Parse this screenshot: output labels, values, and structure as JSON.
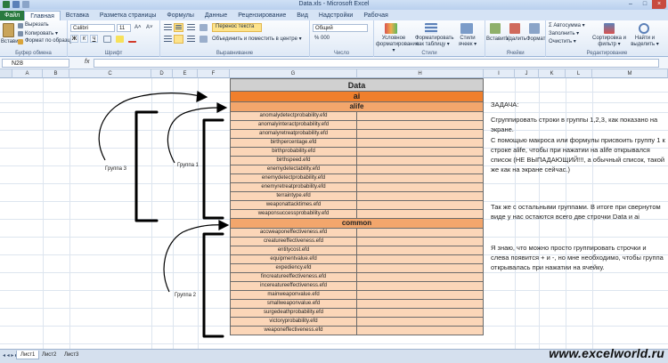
{
  "window": {
    "title": "Data.xls - Microsoft Excel",
    "minimize": "–",
    "maximize": "□",
    "close": "×"
  },
  "tabs": [
    "Файл",
    "Главная",
    "Вставка",
    "Разметка страницы",
    "Формулы",
    "Данные",
    "Рецензирование",
    "Вид",
    "Надстройки",
    "Рабочая"
  ],
  "ribbon": {
    "clipboard": {
      "paste": "Вставить",
      "cut": "Вырезать",
      "copy": "Копировать ▾",
      "format_painter": "Формат по образцу",
      "label": "Буфер обмена"
    },
    "font": {
      "name": "Calibri",
      "size": "11",
      "bold": "Ж",
      "italic": "К",
      "underline": "Ч",
      "grow": "A˄",
      "shrink": "A˅",
      "label": "Шрифт"
    },
    "alignment": {
      "wrap": "Перенос текста",
      "merge": "Объединить и поместить в центре ▾",
      "label": "Выравнивание"
    },
    "number": {
      "format": "Общий",
      "currency": "% 000",
      "label": "Число"
    },
    "styles": {
      "conditional": "Условное форматирование ▾",
      "as_table": "Форматировать как таблицу ▾",
      "cell_styles": "Стили ячеек ▾",
      "label": "Стили"
    },
    "cells": {
      "insert": "Вставить",
      "delete": "Удалить",
      "format": "Формат",
      "label": "Ячейки"
    },
    "editing": {
      "autosum": "Σ Автосумма ▾",
      "fill": "Заполнить ▾",
      "clear": "Очистить ▾",
      "sort": "Сортировка и фильтр ▾",
      "find": "Найти и выделить ▾",
      "label": "Редактирование"
    }
  },
  "formula_bar": {
    "name_box": "N28",
    "fx": "fx",
    "value": ""
  },
  "columns": [
    "A",
    "B",
    "C",
    "D",
    "E",
    "F",
    "G",
    "H",
    "I",
    "J",
    "K",
    "L",
    "M"
  ],
  "table": {
    "title": "Data",
    "section_ai": "ai",
    "section_alife": "alife",
    "alife_rows": [
      "anomalydetectprobability.efd",
      "anomalyinteractprobability.efd",
      "anomalyretreatprobability.efd",
      "birthpercentage.efd",
      "birthprobability.efd",
      "birthspeed.efd",
      "enemydetectability.efd",
      "enemydetectprobability.efd",
      "enemyretreatprobability.efd",
      "terraintype.efd",
      "weaponattacktimes.efd",
      "weaponsuccessprobability.efd"
    ],
    "section_common": "common",
    "common_rows": [
      "accweaponeffectiveness.efd",
      "creatureeffectiveness.efd",
      "entitycost.efd",
      "equipmentvalue.efd",
      "expediency.efd",
      "fincreatureeffectiveness.efd",
      "incereatureeffectiveness.efd",
      "mainweaponvalue.efd",
      "smallweaponvalue.efd",
      "surgedeathprobability.efd",
      "victoryprobability.efd",
      "weaponeffectiveness.efd"
    ]
  },
  "annotations": {
    "group1": "Группа 1",
    "group2": "Группа 2",
    "group3": "Группа 3"
  },
  "task": {
    "heading": "ЗАДАЧА:",
    "p1": "Сгруппировать строки в группы 1,2,3, как показано на экране.",
    "p2": "С помощью макроса или формулы присвоить группу 1 к строке alife, чтобы при нажатии на alife открывался список (НЕ ВЫПАДАЮЩИЙ!!!, а обычный список, такой же как на экране сейчас.)",
    "p3": "Так же с остальными группами. В итоге при свернутом виде у нас остаются всего две строчки Data и ai",
    "p4": "Я знаю, что можно просто группировать строчки и слева появится + и -, но мне необходимо, чтобы группа открывалась при нажатии на ячейку."
  },
  "sheets": [
    "Лист1",
    "Лист2",
    "Лист3"
  ],
  "watermark": "www.excelworld.ru",
  "colors": {
    "header_gray": "#d0d0d0",
    "orange": "#f07f2c",
    "light_orange": "#f3a66c",
    "peach": "#fbd6b8"
  }
}
